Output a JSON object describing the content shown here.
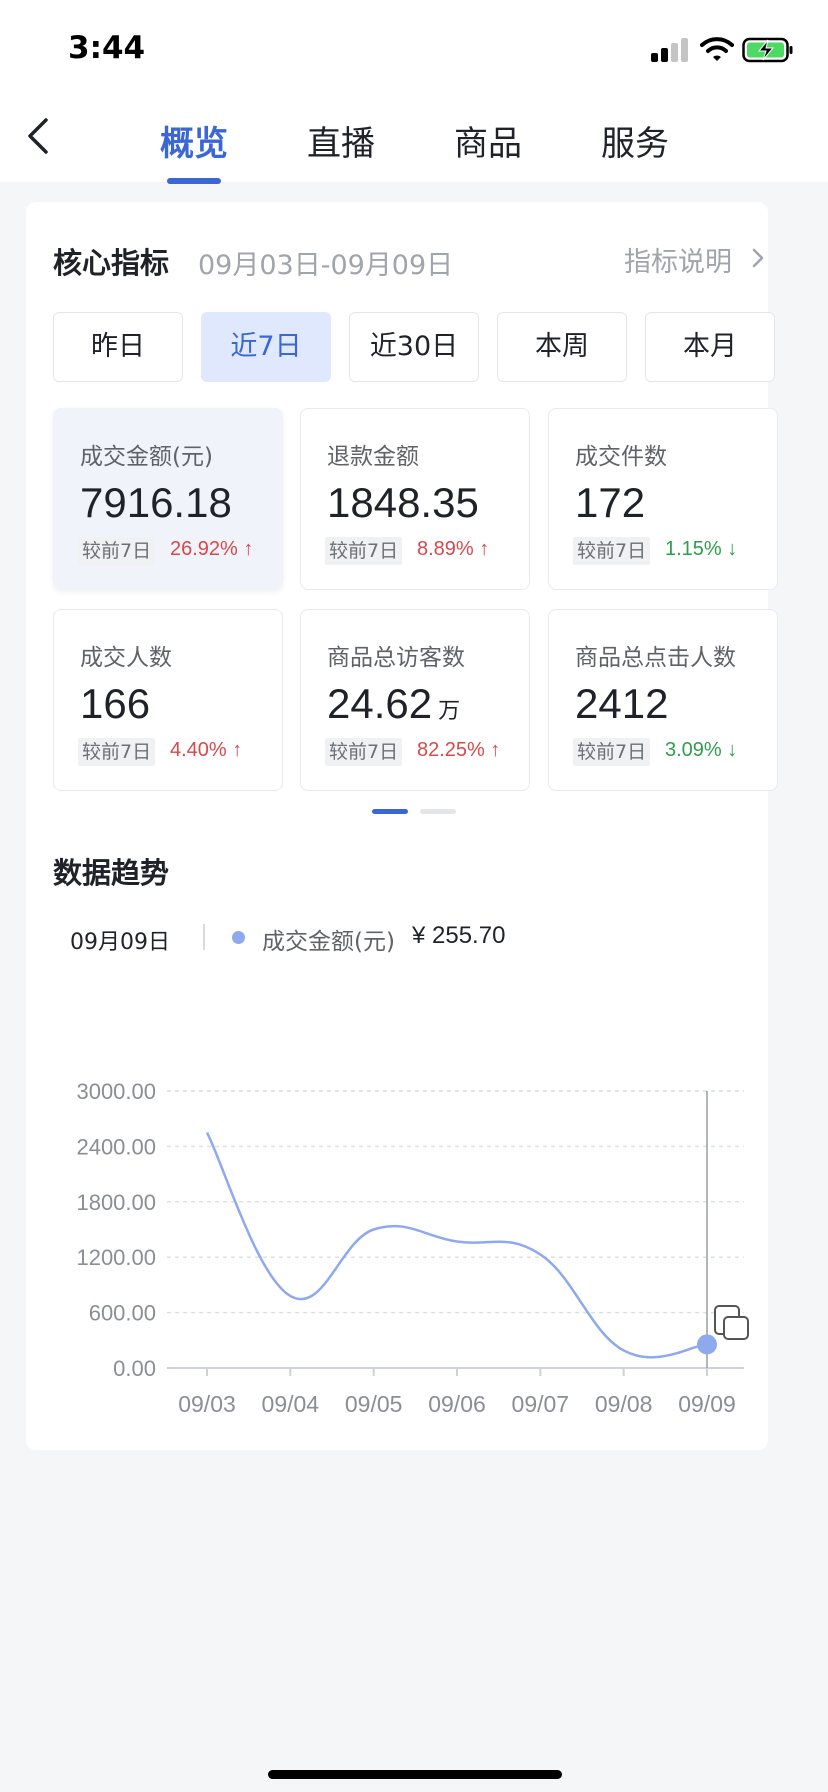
{
  "status_bar": {
    "time": "3:44"
  },
  "nav": {
    "tabs": [
      {
        "label": "概览",
        "active": true
      },
      {
        "label": "直播",
        "active": false
      },
      {
        "label": "商品",
        "active": false
      },
      {
        "label": "服务",
        "active": false
      }
    ]
  },
  "core": {
    "title": "核心指标",
    "date_range": "09月03日-09月09日",
    "info_link": "指标说明",
    "periods": [
      "昨日",
      "近7日",
      "近30日",
      "本周",
      "本月"
    ],
    "active_period": "近7日",
    "metrics": [
      {
        "label": "成交金额(元)",
        "value": "7916.18",
        "unit": "",
        "compare": "较前7日",
        "change": "26.92%",
        "direction": "up"
      },
      {
        "label": "退款金额",
        "value": "1848.35",
        "unit": "",
        "compare": "较前7日",
        "change": "8.89%",
        "direction": "up"
      },
      {
        "label": "成交件数",
        "value": "172",
        "unit": "",
        "compare": "较前7日",
        "change": "1.15%",
        "direction": "down"
      },
      {
        "label": "成交人数",
        "value": "166",
        "unit": "",
        "compare": "较前7日",
        "change": "4.40%",
        "direction": "up"
      },
      {
        "label": "商品总访客数",
        "value": "24.62",
        "unit": "万",
        "compare": "较前7日",
        "change": "82.25%",
        "direction": "up"
      },
      {
        "label": "商品总点击人数",
        "value": "2412",
        "unit": "",
        "compare": "较前7日",
        "change": "3.09%",
        "direction": "down"
      }
    ],
    "pager": {
      "pages": 2,
      "current": 1
    }
  },
  "trend": {
    "title": "数据趋势",
    "legend": {
      "date": "09月09日",
      "series_name": "成交金额(元)",
      "value": "¥ 255.70"
    }
  },
  "colors": {
    "accent": "#3a66d6",
    "up": "#d9484a",
    "down": "#2e9e4c",
    "series": "#8fa9ee"
  },
  "chart_data": {
    "type": "line",
    "x": [
      "09/03",
      "09/04",
      "09/05",
      "09/06",
      "09/07",
      "09/08",
      "09/09"
    ],
    "series": [
      {
        "name": "成交金额(元)",
        "values": [
          2550,
          780,
          1500,
          1370,
          1230,
          190,
          255.7
        ]
      }
    ],
    "y_ticks": [
      "0.00",
      "600.00",
      "1200.00",
      "1800.00",
      "2400.00",
      "3000.00"
    ],
    "ylim": [
      0,
      3000
    ],
    "grid": true,
    "highlighted_category": "09/09"
  }
}
